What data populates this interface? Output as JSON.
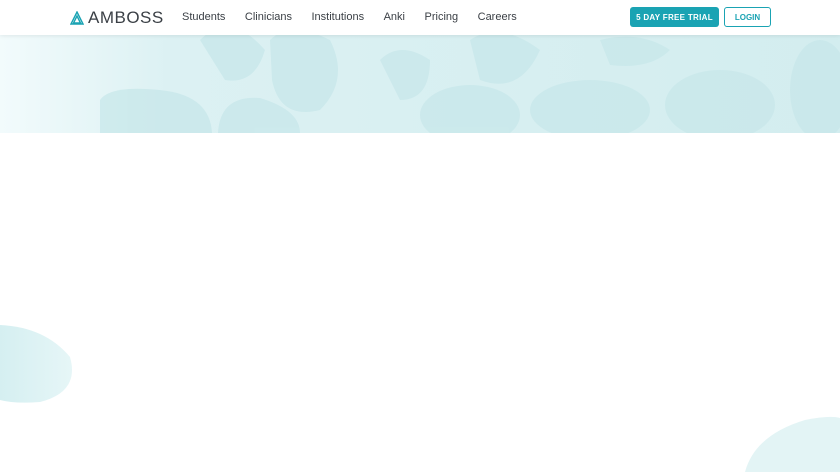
{
  "header": {
    "logo_text": "AMBOSS",
    "nav": [
      "Students",
      "Clinicians",
      "Institutions",
      "Anki",
      "Pricing",
      "Careers"
    ],
    "trial_button": "5 DAY FREE TRIAL",
    "login_button": "LOGIN"
  },
  "colors": {
    "accent": "#1aa3b3",
    "band": "#d5eef0"
  }
}
